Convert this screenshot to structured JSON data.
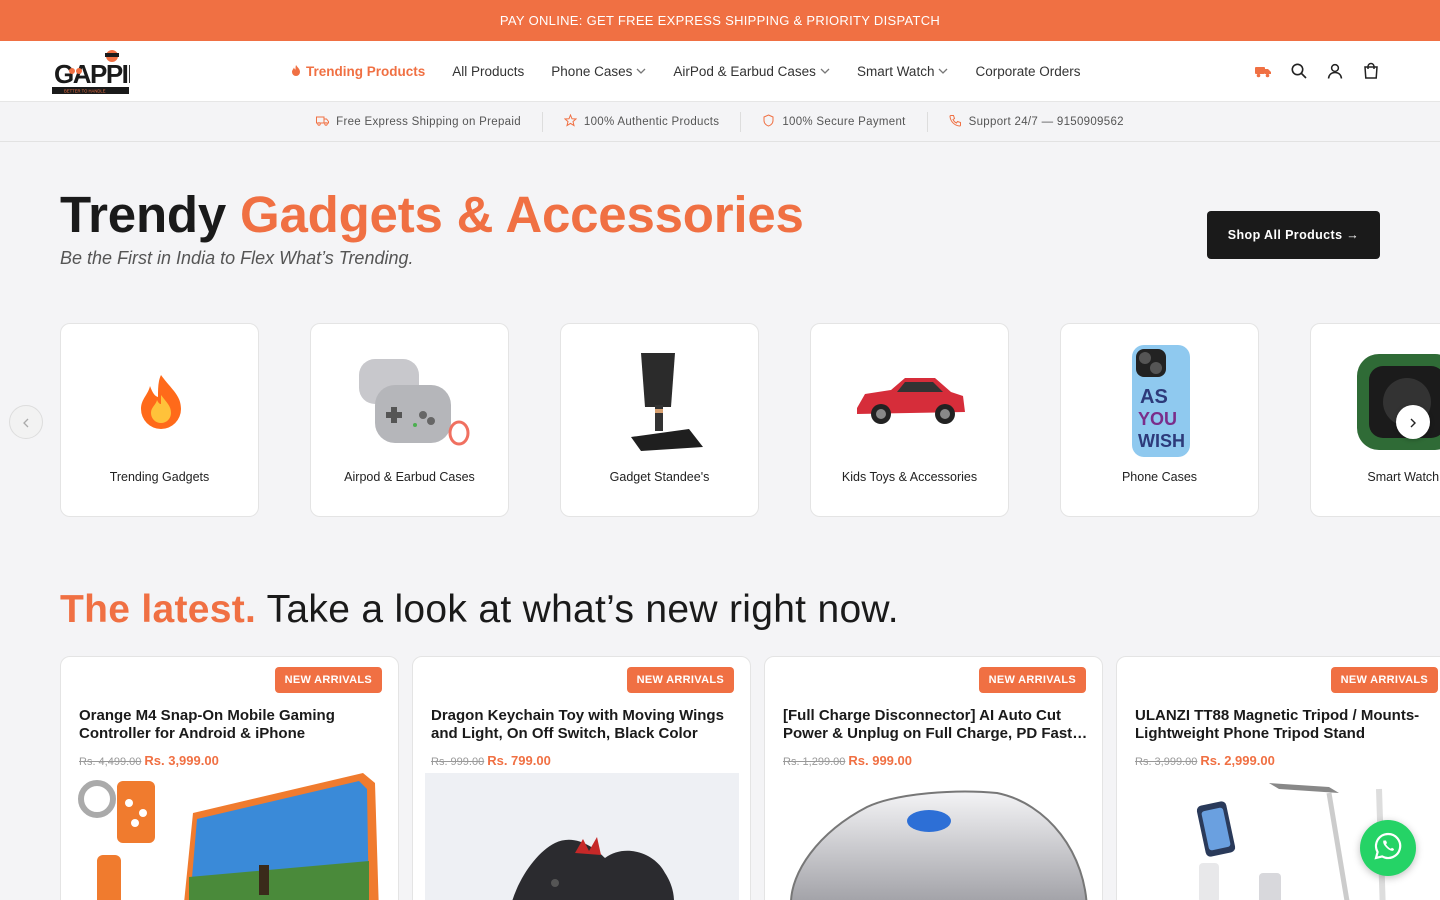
{
  "announcement": "PAY ONLINE: GET FREE EXPRESS SHIPPING & PRIORITY DISPATCH",
  "logo": {
    "text": "GAPPIE",
    "tagline": "BETTER TO HANDLE"
  },
  "nav": {
    "trending": "Trending Products",
    "all_products": "All Products",
    "phone_cases": "Phone Cases",
    "airpod_cases": "AirPod & Earbud Cases",
    "smart_watch": "Smart Watch",
    "corporate": "Corporate Orders"
  },
  "header_icons": [
    "truck-icon",
    "search-icon",
    "account-icon",
    "cart-icon"
  ],
  "trust": {
    "shipping": "Free Express Shipping on Prepaid",
    "authentic": "100% Authentic Products",
    "secure": "100% Secure Payment",
    "support": "Support 24/7 — 9150909562"
  },
  "hero": {
    "title_plain": "Trendy ",
    "title_accent": "Gadgets & Accessories",
    "subtitle": "Be the First in India to Flex What’s Trending.",
    "cta": "Shop All Products →"
  },
  "categories": [
    {
      "label": "Trending Gadgets",
      "icon": "fire-icon"
    },
    {
      "label": "Airpod & Earbud Cases",
      "icon": "airpod-case-icon"
    },
    {
      "label": "Gadget Standee's",
      "icon": "stand-icon"
    },
    {
      "label": "Kids Toys & Accessories",
      "icon": "car-icon"
    },
    {
      "label": "Phone Cases",
      "icon": "phone-case-icon"
    },
    {
      "label": "Smart Watch C",
      "icon": "watch-case-icon"
    }
  ],
  "latest": {
    "accent": "The latest.",
    "rest": " Take a look at what’s new right now."
  },
  "products": [
    {
      "badge": "NEW ARRIVALS",
      "title": "Orange M4 Snap-On Mobile Gaming Controller for Android & iPhone",
      "old_price": "Rs. 4,499.00",
      "price": "Rs. 3,999.00"
    },
    {
      "badge": "NEW ARRIVALS",
      "title": "Dragon Keychain Toy with Moving Wings and Light, On Off Switch, Black Color",
      "old_price": "Rs. 999.00",
      "price": "Rs. 799.00"
    },
    {
      "badge": "NEW ARRIVALS",
      "title": "[Full Charge Disconnector] AI Auto Cut Power & Unplug on Full Charge, PD Fast Charging",
      "old_price": "Rs. 1,299.00",
      "price": "Rs. 999.00"
    },
    {
      "badge": "NEW ARRIVALS",
      "title": "ULANZI TT88 Magnetic Tripod / Mounts-Lightweight Phone Tripod Stand",
      "old_price": "Rs. 3,999.00",
      "price": "Rs. 2,999.00"
    }
  ],
  "colors": {
    "accent": "#f07043",
    "dark": "#1a1a1a",
    "whatsapp": "#25d366"
  }
}
